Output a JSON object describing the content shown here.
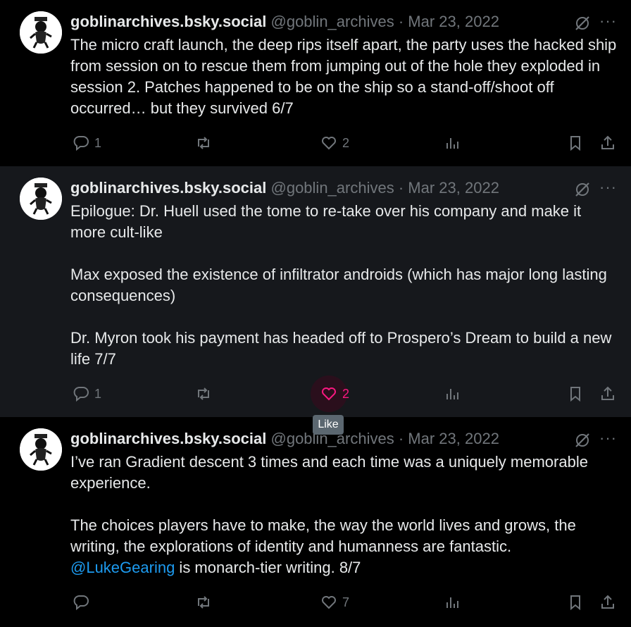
{
  "tweets": [
    {
      "name": "goblinarchives.bsky.social",
      "handle": "@goblin_archives",
      "sep": "·",
      "date": "Mar 23, 2022",
      "more": "···",
      "text": "The micro craft launch, the deep rips itself apart, the party uses the hacked ship from session on to rescue them from jumping out of the hole they exploded in session 2. Patches happened to be on the ship so a stand-off/shoot off occurred… but they survived 6/7",
      "replies": "1",
      "likes": "2",
      "liked": false
    },
    {
      "name": "goblinarchives.bsky.social",
      "handle": "@goblin_archives",
      "sep": "·",
      "date": "Mar 23, 2022",
      "more": "···",
      "text": "Epilogue: Dr. Huell used the tome to re-take over his company and make it more cult-like\n\nMax exposed the existence of infiltrator androids (which has major long lasting consequences)\n\nDr. Myron took his payment has headed off to Prospero’s Dream to build a new life 7/7",
      "replies": "1",
      "likes": "2",
      "liked": true
    },
    {
      "name": "goblinarchives.bsky.social",
      "handle": "@goblin_archives",
      "sep": "·",
      "date": "Mar 23, 2022",
      "more": "···",
      "text_before": "I’ve ran Gradient descent 3 times and each time was a uniquely memorable experience.\n\nThe choices players have to make, the way the world lives and grows, the writing, the explorations of identity and humanness are fantastic.\n",
      "mention": "@LukeGearing",
      "text_after": " is monarch-tier writing. 8/7",
      "replies": "",
      "likes": "7",
      "liked": false
    }
  ],
  "tooltip": "Like",
  "colors": {
    "accent": "#1d9bf0",
    "like": "#f91880",
    "muted": "#71767b",
    "text": "#e7e9ea"
  },
  "icons": [
    "reply-icon",
    "retweet-icon",
    "heart-icon",
    "views-icon",
    "bookmark-icon",
    "share-icon",
    "grok-icon",
    "more-icon"
  ]
}
